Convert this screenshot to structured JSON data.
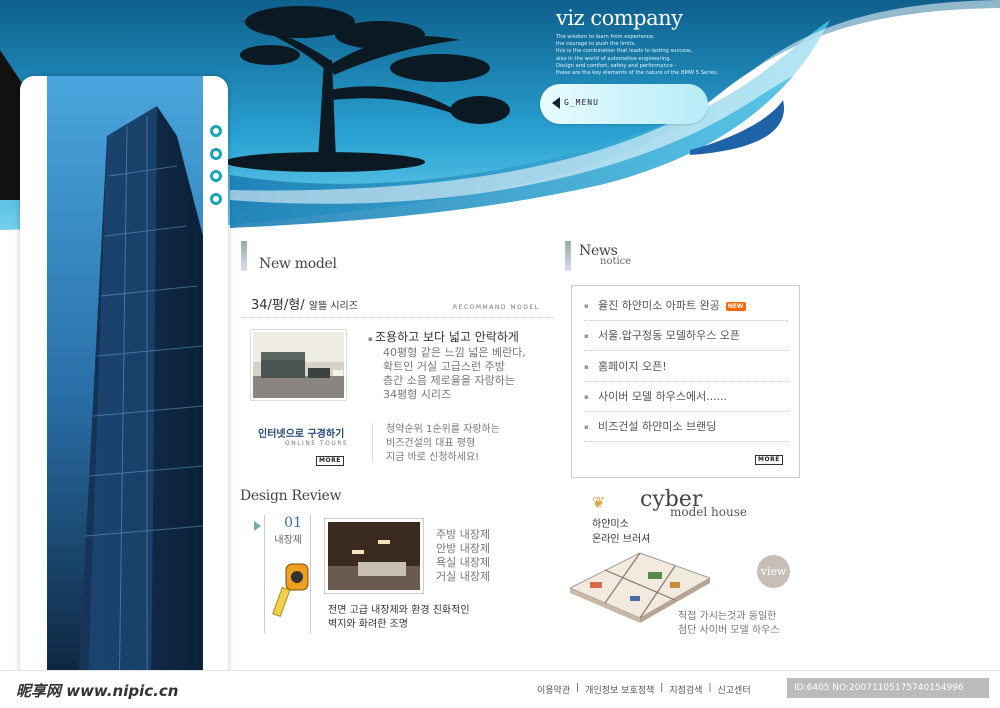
{
  "brand": {
    "title": "viz company",
    "lines": [
      "The wisdom to learn from experience,",
      "the courage to push the limits.",
      "this is the combination that leads to lasting success,",
      "also in the world of automotive engineering.",
      "Design and comfort, safety and performance -",
      "these are the key elements of the nature of the BMW 5 Series."
    ],
    "menu_label": "G_MENU"
  },
  "new_model": {
    "title": "New model",
    "series": "34/평/형/",
    "series_sub": "알뜰 시리즈",
    "tag": "RECOMMAND MODEL",
    "headline": "조용하고 보다 넓고 안락하게",
    "desc": [
      "40평형 같은 느낌 넓은 베란다,",
      "확트인 거실 고급스런 주방",
      "층간 소음 제로율을 자랑하는",
      "34평형 시리즈"
    ],
    "tour_title": "인터넷으로 구경하기",
    "tour_sub": "ONLINE TOURE",
    "more_label": "MORE",
    "promo": [
      "청약순위 1순위를 자랑하는",
      "비즈건설의 대표 평형",
      "지금 바로 신청하세요!"
    ]
  },
  "news": {
    "title": "News",
    "subtitle": "notice",
    "items": [
      {
        "label": "율진 하얀미소  아파트 완공",
        "badge": "NEW"
      },
      {
        "label": "서울.압구정동 모델하우스 오픈",
        "badge": ""
      },
      {
        "label": "홈페이지 오픈!",
        "badge": ""
      },
      {
        "label": "사이버 모델 하우스에서......",
        "badge": ""
      },
      {
        "label": "비즈건설 하얀미소 브랜딩",
        "badge": ""
      }
    ],
    "more_label": "MORE"
  },
  "design_review": {
    "title": "Design Review",
    "number": "01",
    "category": "내장제",
    "list": [
      "주방 내장제",
      "안방 내장제",
      "욕실 내장제",
      "거실 내장제"
    ],
    "caption": [
      "전면 고급 내장제와 환경 친화적인",
      "벽지와 화려한 조명"
    ]
  },
  "cyber": {
    "title": "cyber",
    "subtitle": "model house",
    "brand_lines": [
      "하얀미소",
      "온라인 브러셔"
    ],
    "view_label": "view",
    "caption": [
      "직접 가시는것과 동일한",
      "첨단 사이버 모델 하우스"
    ]
  },
  "footer": {
    "links": [
      "이용약관",
      "개인정보 보호정책",
      "지점검색",
      "신고센터"
    ],
    "separator": "|",
    "watermark": "昵享网 www.nipic.cn",
    "id_text": "ID:6405 NO:20071105175740154996"
  },
  "colors": {
    "accent": "#1aa5b5",
    "sky": "#1d8fc7",
    "dark_blue": "#0f3a5c"
  }
}
